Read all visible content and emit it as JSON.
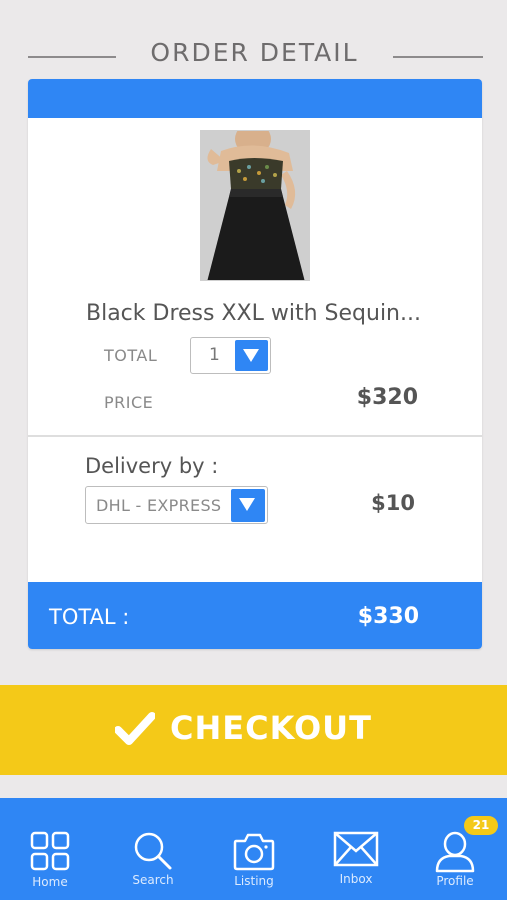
{
  "header": {
    "title": "ORDER DETAIL"
  },
  "product": {
    "name": "Black Dress XXL with Sequin...",
    "total_label": "TOTAL",
    "quantity": "1",
    "price_label": "PRICE",
    "price": "$320"
  },
  "delivery": {
    "label": "Delivery by :",
    "courier": "DHL - EXPRESS",
    "price": "$10"
  },
  "summary": {
    "total_label": "TOTAL :",
    "total_value": "$330"
  },
  "checkout": {
    "label": "CHECKOUT"
  },
  "nav": {
    "items": [
      {
        "label": "Home",
        "icon": "grid-icon"
      },
      {
        "label": "Search",
        "icon": "search-icon"
      },
      {
        "label": "Listing",
        "icon": "camera-icon"
      },
      {
        "label": "Inbox",
        "icon": "envelope-icon"
      },
      {
        "label": "Profile",
        "icon": "profile-icon"
      }
    ],
    "profile_badge": "21"
  },
  "colors": {
    "accent_blue": "#2f86f4",
    "checkout_yellow": "#f4c918",
    "background": "#ebe9ea"
  }
}
